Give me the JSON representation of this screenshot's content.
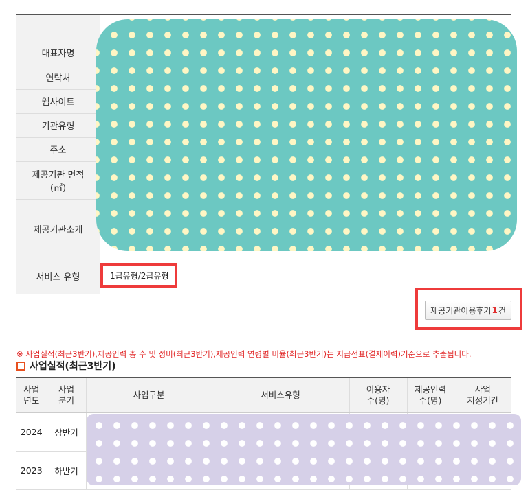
{
  "provider_info": {
    "rows": [
      {
        "label": "대표자명"
      },
      {
        "label": "연락처"
      },
      {
        "label": "웹사이트"
      },
      {
        "label": "기관유형"
      },
      {
        "label": "주소"
      },
      {
        "label": "제공기관 면적",
        "label2": "(㎡)"
      },
      {
        "label": "제공기관소개"
      },
      {
        "label": "서비스 유형",
        "value": "1급유형/2급유형"
      }
    ]
  },
  "review_button": {
    "label": "제공기관이용후기",
    "count": "1",
    "unit": "건"
  },
  "notice": "※ 사업실적(최근3반기),제공인력 총 수 및 성비(최근3반기),제공인력 연령별 비율(최근3반기)는 지급전표(결제이력)기준으로 추출됩니다.",
  "performance": {
    "title": "사업실적(최근3반기)",
    "headers": [
      [
        "사업",
        "년도"
      ],
      [
        "사업",
        "분기"
      ],
      [
        "사업구분",
        ""
      ],
      [
        "서비스유형",
        ""
      ],
      [
        "이용자",
        "수(명)"
      ],
      [
        "제공인력",
        "수(명)"
      ],
      [
        "사업",
        "지정기간"
      ]
    ],
    "rows": [
      {
        "year": "2024",
        "half": "상반기"
      },
      {
        "year": "2023",
        "half": "하반기"
      }
    ]
  },
  "colors": {
    "highlight_red": "#ee3b3b",
    "notice_red": "#e12626",
    "icon_orange": "#e8501e"
  }
}
